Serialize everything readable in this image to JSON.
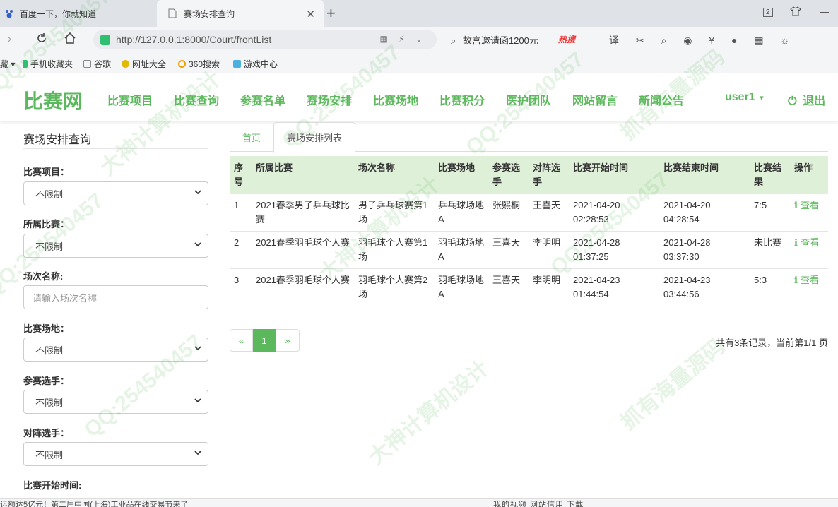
{
  "browser": {
    "tabs": [
      {
        "title": "百度一下，你就知道",
        "active": false
      },
      {
        "title": "赛场安排查询",
        "active": true
      }
    ],
    "url": "http://127.0.0.1:8000/Court/frontList",
    "search_text": "故宫邀请函1200元",
    "hot_label": "热搜",
    "tab_count": "2",
    "bookmarks": [
      "藏",
      "手机收藏夹",
      "谷歌",
      "网址大全",
      "360搜索",
      "游戏中心"
    ],
    "status_news": "运额达5亿元！第二届中国(上海)工业品在线交易节来了",
    "status_right": "我的视频   网站信用                                  下载"
  },
  "site": {
    "logo": "比赛网",
    "nav": [
      "比赛项目",
      "比赛查询",
      "参赛名单",
      "赛场安排",
      "比赛场地",
      "比赛积分",
      "医护团队",
      "网站留言",
      "新闻公告"
    ],
    "user": "user1",
    "logout": "退出",
    "accent": "#5cb85c"
  },
  "filters": {
    "title": "赛场安排查询",
    "fields": [
      {
        "label": "比赛项目：",
        "type": "select",
        "value": "不限制"
      },
      {
        "label": "所属比赛：",
        "type": "select",
        "value": "不限制"
      },
      {
        "label": "场次名称:",
        "type": "input",
        "placeholder": "请输入场次名称"
      },
      {
        "label": "比赛场地：",
        "type": "select",
        "value": "不限制"
      },
      {
        "label": "参赛选手：",
        "type": "select",
        "value": "不限制"
      },
      {
        "label": "对阵选手：",
        "type": "select",
        "value": "不限制"
      },
      {
        "label": "比赛开始时间:",
        "type": "label"
      }
    ]
  },
  "main": {
    "tabs": [
      "首页",
      "赛场安排列表"
    ],
    "table": {
      "headers": [
        "序号",
        "所属比赛",
        "场次名称",
        "比赛场地",
        "参赛选手",
        "对阵选手",
        "比赛开始时间",
        "比赛结束时间",
        "比赛结果",
        "操作"
      ],
      "rows": [
        [
          "1",
          "2021春季男子乒乓球比赛",
          "男子乒乓球赛第1场",
          "乒乓球场地A",
          "张熙桐",
          "王喜天",
          "2021-04-20 02:28:53",
          "2021-04-20 04:28:54",
          "7:5",
          "查看"
        ],
        [
          "2",
          "2021春季羽毛球个人赛",
          "羽毛球个人赛第1场",
          "羽毛球场地A",
          "王喜天",
          "李明明",
          "2021-04-28 01:37:25",
          "2021-04-28 03:37:30",
          "未比赛",
          "查看"
        ],
        [
          "3",
          "2021春季羽毛球个人赛",
          "羽毛球个人赛第2场",
          "羽毛球场地A",
          "王喜天",
          "李明明",
          "2021-04-23 01:44:54",
          "2021-04-23 03:44:56",
          "5:3",
          "查看"
        ]
      ]
    },
    "pager": {
      "prev": "«",
      "current": "1",
      "next": "»"
    },
    "page_info": "共有3条记录，当前第1/1 页"
  },
  "watermark": [
    "QQ:254540457",
    "大神计算机设计",
    "抓有海量源码"
  ]
}
